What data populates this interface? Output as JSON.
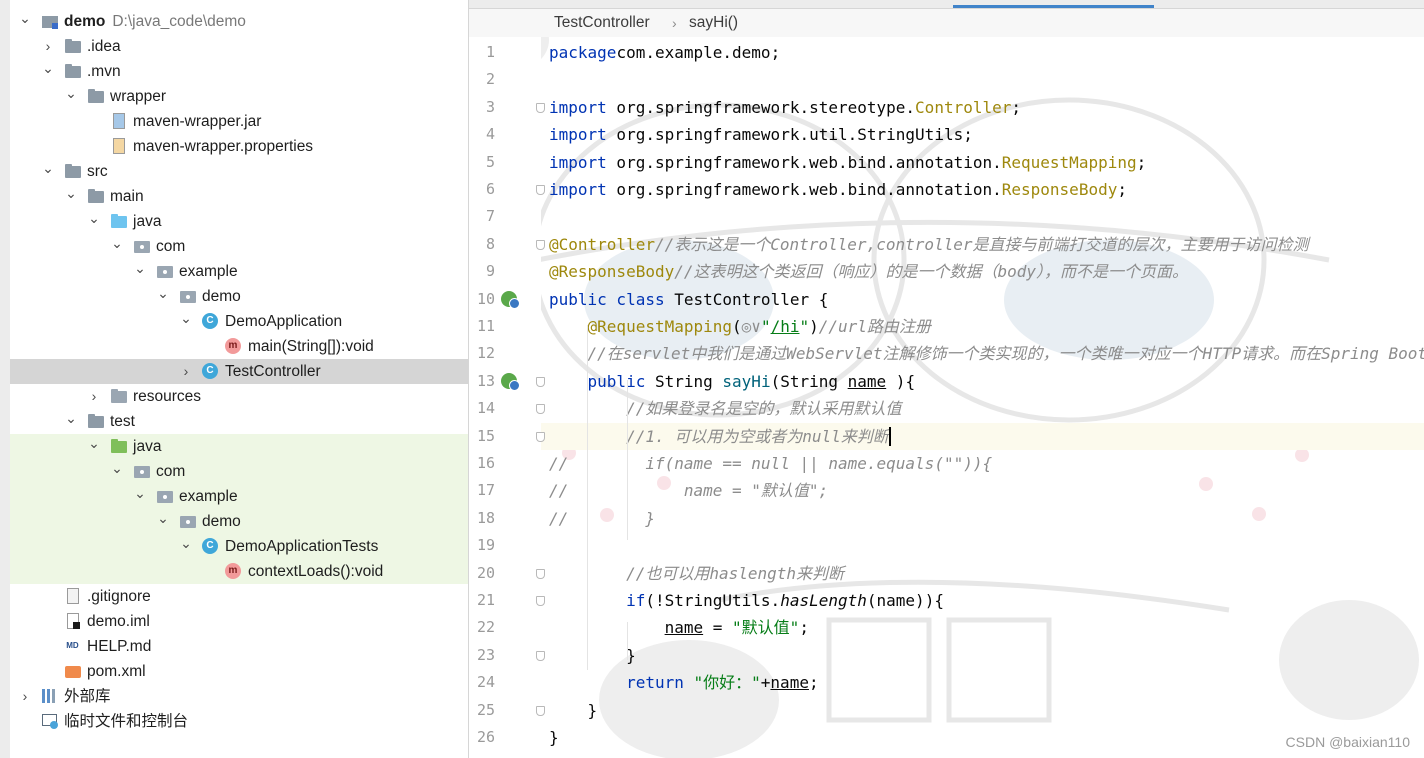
{
  "project_tree": {
    "items": [
      {
        "label": "demo",
        "path": "D:\\java_code\\demo",
        "icon": "module-folder-icon",
        "arrow": "expanded"
      },
      {
        "label": ".idea",
        "icon": "folder-icon",
        "arrow": "collapsed"
      },
      {
        "label": ".mvn",
        "icon": "folder-icon",
        "arrow": "expanded"
      },
      {
        "label": "wrapper",
        "icon": "folder-icon",
        "arrow": "expanded"
      },
      {
        "label": "maven-wrapper.jar",
        "icon": "jar-file-icon",
        "arrow": "none"
      },
      {
        "label": "maven-wrapper.properties",
        "icon": "properties-file-icon",
        "arrow": "none"
      },
      {
        "label": "src",
        "icon": "folder-icon",
        "arrow": "expanded"
      },
      {
        "label": "main",
        "icon": "folder-icon",
        "arrow": "expanded"
      },
      {
        "label": "java",
        "icon": "source-folder-icon",
        "arrow": "expanded"
      },
      {
        "label": "com",
        "icon": "package-icon",
        "arrow": "expanded"
      },
      {
        "label": "example",
        "icon": "package-icon",
        "arrow": "expanded"
      },
      {
        "label": "demo",
        "icon": "package-icon",
        "arrow": "expanded"
      },
      {
        "label": "DemoApplication",
        "icon": "spring-class-icon",
        "arrow": "expanded"
      },
      {
        "label": "main(String[]):void",
        "icon": "method-icon",
        "arrow": "none"
      },
      {
        "label": "TestController",
        "icon": "class-icon",
        "arrow": "collapsed",
        "selected": true
      },
      {
        "label": "resources",
        "icon": "resources-folder-icon",
        "arrow": "collapsed"
      },
      {
        "label": "test",
        "icon": "folder-icon",
        "arrow": "expanded"
      },
      {
        "label": "java",
        "icon": "test-folder-icon",
        "arrow": "expanded"
      },
      {
        "label": "com",
        "icon": "package-icon",
        "arrow": "expanded"
      },
      {
        "label": "example",
        "icon": "package-icon",
        "arrow": "expanded"
      },
      {
        "label": "demo",
        "icon": "package-icon",
        "arrow": "expanded"
      },
      {
        "label": "DemoApplicationTests",
        "icon": "spring-class-icon",
        "arrow": "expanded"
      },
      {
        "label": "contextLoads():void",
        "icon": "test-method-icon",
        "arrow": "none"
      },
      {
        "label": ".gitignore",
        "icon": "gitignore-file-icon",
        "arrow": "none"
      },
      {
        "label": "demo.iml",
        "icon": "iml-file-icon",
        "arrow": "none"
      },
      {
        "label": "HELP.md",
        "icon": "markdown-file-icon",
        "arrow": "none"
      },
      {
        "label": "pom.xml",
        "icon": "maven-pom-icon",
        "arrow": "none"
      },
      {
        "label": "外部库",
        "icon": "external-libraries-icon",
        "arrow": "collapsed"
      },
      {
        "label": "临时文件和控制台",
        "icon": "scratches-icon",
        "arrow": "none"
      }
    ]
  },
  "breadcrumb": [
    "TestController",
    "sayHi()"
  ],
  "editor": {
    "lines": [
      {
        "n": "1",
        "parts": [
          [
            "kw",
            "package"
          ],
          [
            "",
            "com.example.demo;"
          ]
        ]
      },
      {
        "n": "2",
        "parts": []
      },
      {
        "n": "3",
        "parts": [
          [
            "kw",
            "import"
          ],
          [
            "",
            " org.springframework.stereotype."
          ],
          [
            "ann",
            "Controller"
          ],
          [
            "",
            ";"
          ]
        ]
      },
      {
        "n": "4",
        "parts": [
          [
            "kw",
            "import"
          ],
          [
            "",
            " org.springframework.util.StringUtils;"
          ]
        ]
      },
      {
        "n": "5",
        "parts": [
          [
            "kw",
            "import"
          ],
          [
            "",
            " org.springframework.web.bind.annotation."
          ],
          [
            "ann",
            "RequestMapping"
          ],
          [
            "",
            ";"
          ]
        ]
      },
      {
        "n": "6",
        "parts": [
          [
            "kw",
            "import"
          ],
          [
            "",
            " org.springframework.web.bind.annotation."
          ],
          [
            "ann",
            "ResponseBody"
          ],
          [
            "",
            ";"
          ]
        ]
      },
      {
        "n": "7",
        "parts": []
      },
      {
        "n": "8",
        "parts": [
          [
            "ann",
            "@Controller"
          ],
          [
            "cmt",
            "//表示这是一个Controller,controller是直接与前端打交道的层次，主要用于访问检测"
          ]
        ]
      },
      {
        "n": "9",
        "parts": [
          [
            "ann",
            "@ResponseBody"
          ],
          [
            "cmt",
            "//这表明这个类返回（响应）的是一个数据（body），而不是一个页面。"
          ]
        ]
      },
      {
        "n": "10",
        "parts": [
          [
            "kw",
            "public class "
          ],
          [
            "",
            "TestController {"
          ]
        ]
      },
      {
        "n": "11",
        "parts": [
          [
            "",
            "    "
          ],
          [
            "ann",
            "@RequestMapping"
          ],
          [
            "",
            "("
          ],
          [
            "cmt",
            "◎∨"
          ],
          [
            "str",
            "\""
          ],
          [
            "str ul",
            "/hi"
          ],
          [
            "str",
            "\""
          ],
          [
            "",
            ")"
          ],
          [
            "cmt",
            "//url路由注册"
          ]
        ]
      },
      {
        "n": "12",
        "parts": [
          [
            "",
            "    "
          ],
          [
            "cmt",
            "//在servlet中我们是通过WebServlet注解修饰一个类实现的，一个类唯一对应一个HTTP请求。而在Spring Boot"
          ]
        ]
      },
      {
        "n": "13",
        "parts": [
          [
            "",
            "    "
          ],
          [
            "kw",
            "public "
          ],
          [
            "",
            "String "
          ],
          [
            "fn",
            "sayHi"
          ],
          [
            "",
            "(String "
          ],
          [
            "ul",
            "name"
          ],
          [
            "",
            " ){"
          ]
        ]
      },
      {
        "n": "14",
        "parts": [
          [
            "",
            "        "
          ],
          [
            "cmt",
            "//如果登录名是空的，默认采用默认值"
          ]
        ]
      },
      {
        "n": "15",
        "parts": [
          [
            "",
            "        "
          ],
          [
            "cmt",
            "//1. 可以用为空或者为null来判断"
          ]
        ]
      },
      {
        "n": "16",
        "parts": [
          [
            "cmt",
            "//        if(name == null || name.equals(\"\")){"
          ]
        ]
      },
      {
        "n": "17",
        "parts": [
          [
            "cmt",
            "//            name = \"默认值\";"
          ]
        ]
      },
      {
        "n": "18",
        "parts": [
          [
            "cmt",
            "//        }"
          ]
        ]
      },
      {
        "n": "19",
        "parts": []
      },
      {
        "n": "20",
        "parts": [
          [
            "",
            "        "
          ],
          [
            "cmt",
            "//也可以用haslength来判断"
          ]
        ]
      },
      {
        "n": "21",
        "parts": [
          [
            "",
            "        "
          ],
          [
            "kw",
            "if"
          ],
          [
            "",
            "(!StringUtils."
          ],
          [
            "it",
            "hasLength"
          ],
          [
            "",
            "(name)){"
          ]
        ]
      },
      {
        "n": "22",
        "parts": [
          [
            "",
            "            "
          ],
          [
            "ul",
            "name"
          ],
          [
            "",
            " = "
          ],
          [
            "str",
            "\"默认值\""
          ],
          [
            "",
            ";"
          ]
        ]
      },
      {
        "n": "23",
        "parts": [
          [
            "",
            "        }"
          ]
        ]
      },
      {
        "n": "24",
        "parts": [
          [
            "",
            "        "
          ],
          [
            "kw",
            "return "
          ],
          [
            "str",
            "\"你好：\""
          ],
          [
            "",
            "+"
          ],
          [
            "ul",
            "name"
          ],
          [
            "",
            ";"
          ]
        ]
      },
      {
        "n": "25",
        "parts": [
          [
            "",
            "    }"
          ]
        ]
      },
      {
        "n": "26",
        "parts": [
          [
            "",
            "}"
          ]
        ]
      }
    ],
    "current_line": "15"
  },
  "watermark": "CSDN @baixian110",
  "colors": {
    "keyword": "#0033b3",
    "annotation": "#9e880d",
    "comment": "#8c8c8c",
    "string": "#067d17",
    "method_decl": "#00627a",
    "selection_row": "#d5d5d5",
    "test_zone": "#eef7e4",
    "tab_underline": "#4083c9"
  }
}
